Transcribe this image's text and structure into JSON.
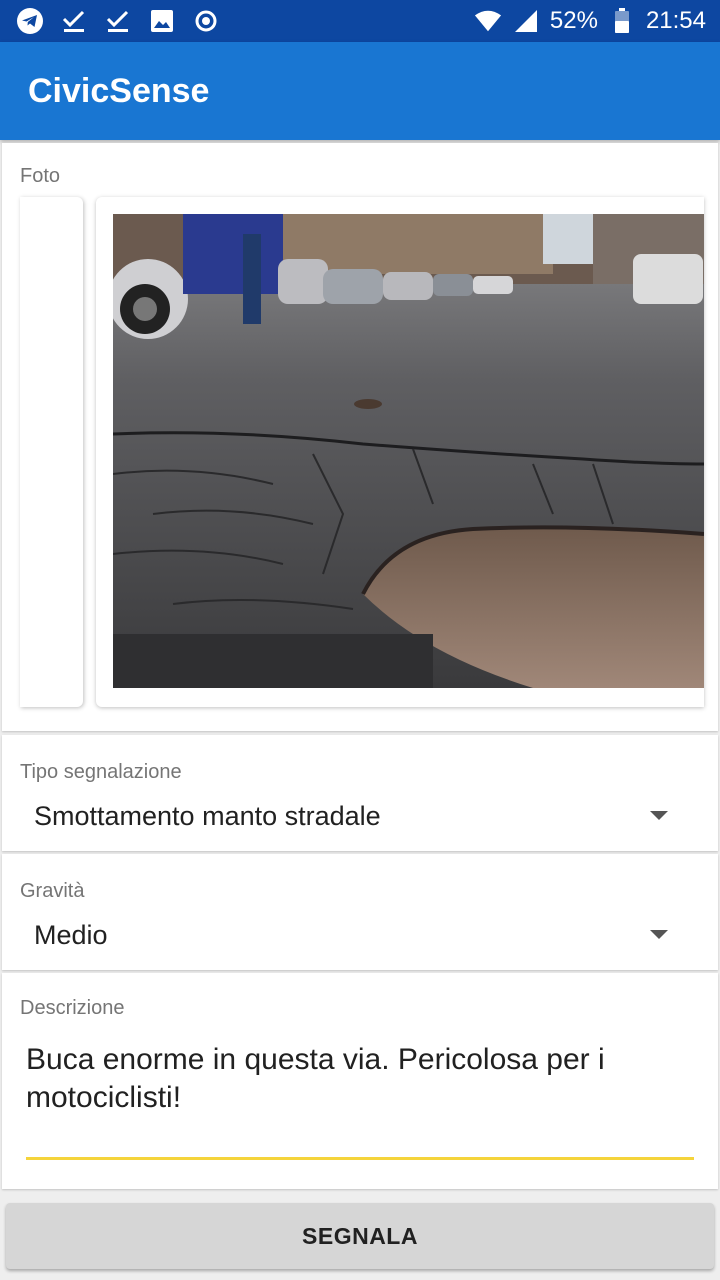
{
  "status_bar": {
    "battery": "52%",
    "time": "21:54",
    "left_icons": [
      "telegram-icon",
      "checkmark-icon",
      "checkmark-icon",
      "image-icon",
      "record-icon"
    ],
    "right_icons": [
      "wifi-icon",
      "signal-icon",
      "battery-icon"
    ]
  },
  "app_bar": {
    "title": "CivicSense"
  },
  "photo_section": {
    "label": "Foto"
  },
  "tipo": {
    "label": "Tipo segnalazione",
    "value": "Smottamento manto stradale"
  },
  "gravita": {
    "label": "Gravità",
    "value": "Medio"
  },
  "descrizione": {
    "label": "Descrizione",
    "value": "Buca enorme in questa via. Pericolosa per i motociclisti!"
  },
  "actions": {
    "submit_label": "SEGNALA"
  },
  "colors": {
    "status_bar": "#0d47a1",
    "app_bar": "#1976d2",
    "underline": "#f5d43b",
    "button": "#d6d6d6"
  }
}
